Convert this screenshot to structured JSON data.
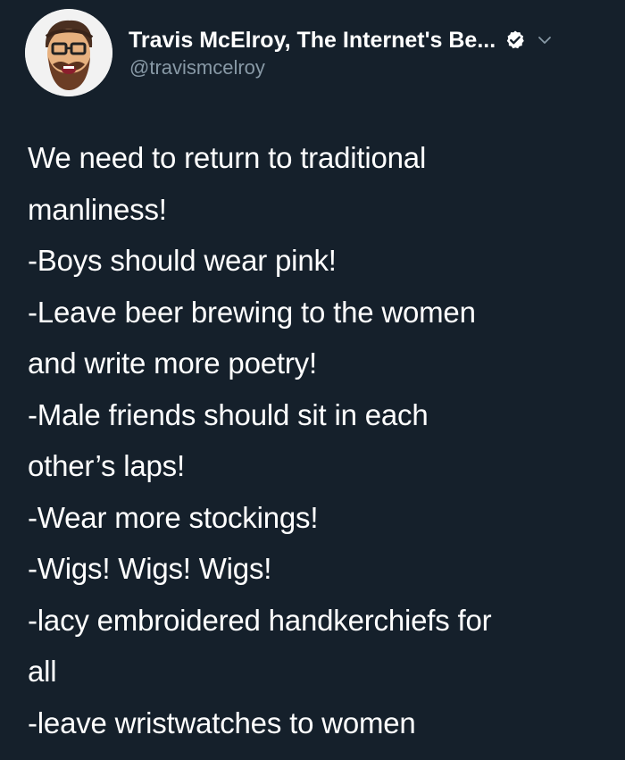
{
  "author": {
    "display_name": "Travis McElroy, The Internet's Be...",
    "handle": "@travismcelroy",
    "avatar_icon": "avatar-bearded-man-glasses",
    "verified_icon": "verified-badge-icon",
    "menu_icon": "chevron-down-icon"
  },
  "tweet": {
    "lines": [
      "We need to return to traditional",
      "manliness!",
      "-Boys should wear pink!",
      "-Leave beer brewing to the women",
      "and write more poetry!",
      "-Male friends should sit in each",
      "other’s laps!",
      "-Wear more stockings!",
      "-Wigs! Wigs! Wigs!",
      "-lacy embroidered handkerchiefs for",
      "all",
      "-leave wristwatches to women"
    ]
  },
  "colors": {
    "background": "#15202b",
    "text": "#ffffff",
    "secondary_text": "#8899a6"
  }
}
